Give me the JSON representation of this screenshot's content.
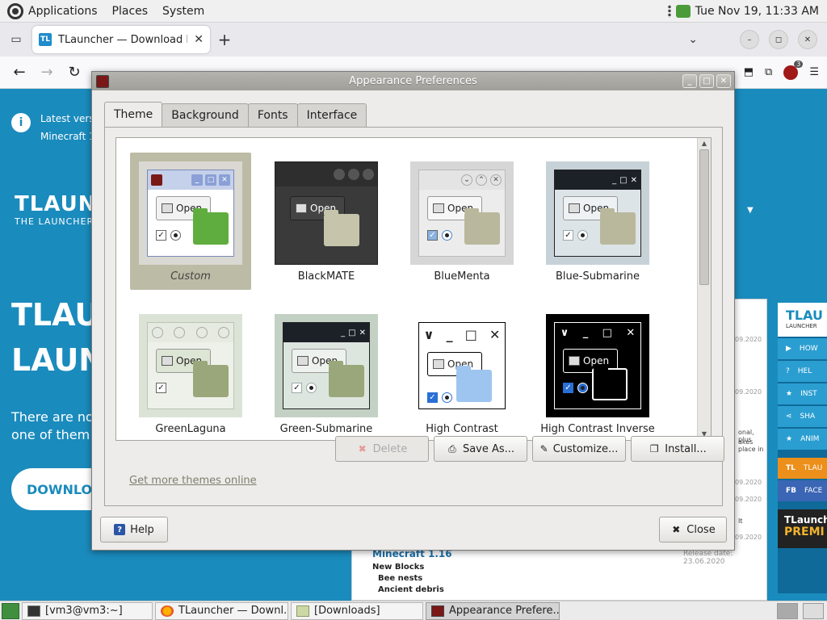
{
  "top_panel": {
    "menus": [
      "Applications",
      "Places",
      "System"
    ],
    "clock": "Tue Nov 19, 11:33 AM"
  },
  "browser": {
    "tab_title": "TLauncher — Download Mi",
    "tab_favicon": "TL",
    "ext_badge": "3"
  },
  "webpage": {
    "notice_line1": "Latest versi",
    "notice_line2": "Minecraft 1",
    "brand_big": "TLAUN",
    "brand_small": "THE LAUNCHER",
    "hero_line1": "TLAU",
    "hero_line2": "LAUN",
    "sub_line1": "There are no",
    "sub_line2": "one of them",
    "download": "DOWNLO",
    "news_title": "Minecraft 1.16",
    "news_line1": "New Blocks",
    "news_line2": "Bee nests",
    "news_line3": "Ancient debris",
    "news_release": "Release date: 23.06.2020",
    "news_dates": [
      "09.2020",
      "09.2020",
      "09.2020",
      "09.2020",
      "09.2020"
    ],
    "news_snip1": "onal, plus",
    "news_snip2": "akes place in",
    "news_snip3": "It",
    "sidebar_head": "TLAU",
    "sidebar_sub": "LAUNCHER",
    "sidebar_items": [
      "HOW",
      "HEL",
      "INST",
      "SHA",
      "ANIM"
    ],
    "sidebar_tl": "TLAU",
    "sidebar_fb": "FACE",
    "sidebar_prem1": "TLaunch",
    "sidebar_prem2": "PREMI"
  },
  "dialog": {
    "title": "Appearance Preferences",
    "tabs": [
      "Theme",
      "Background",
      "Fonts",
      "Interface"
    ],
    "themes": [
      "Custom",
      "BlackMATE",
      "BlueMenta",
      "Blue-Submarine",
      "GreenLaguna",
      "Green-Submarine",
      "High Contrast",
      "High Contrast Inverse"
    ],
    "mini_open": "Open",
    "buttons": {
      "delete": "Delete",
      "save_as": "Save As...",
      "customize": "Customize...",
      "install": "Install..."
    },
    "link": "Get more themes online",
    "help": "Help",
    "close": "Close"
  },
  "taskbar": {
    "items": [
      "[vm3@vm3:~]",
      "TLauncher — Downl...",
      "[Downloads]",
      "Appearance Prefere..."
    ]
  },
  "colors": {
    "site_blue": "#1a8bbd",
    "selection": "#bcbca6",
    "link": "#7f7f6c"
  }
}
